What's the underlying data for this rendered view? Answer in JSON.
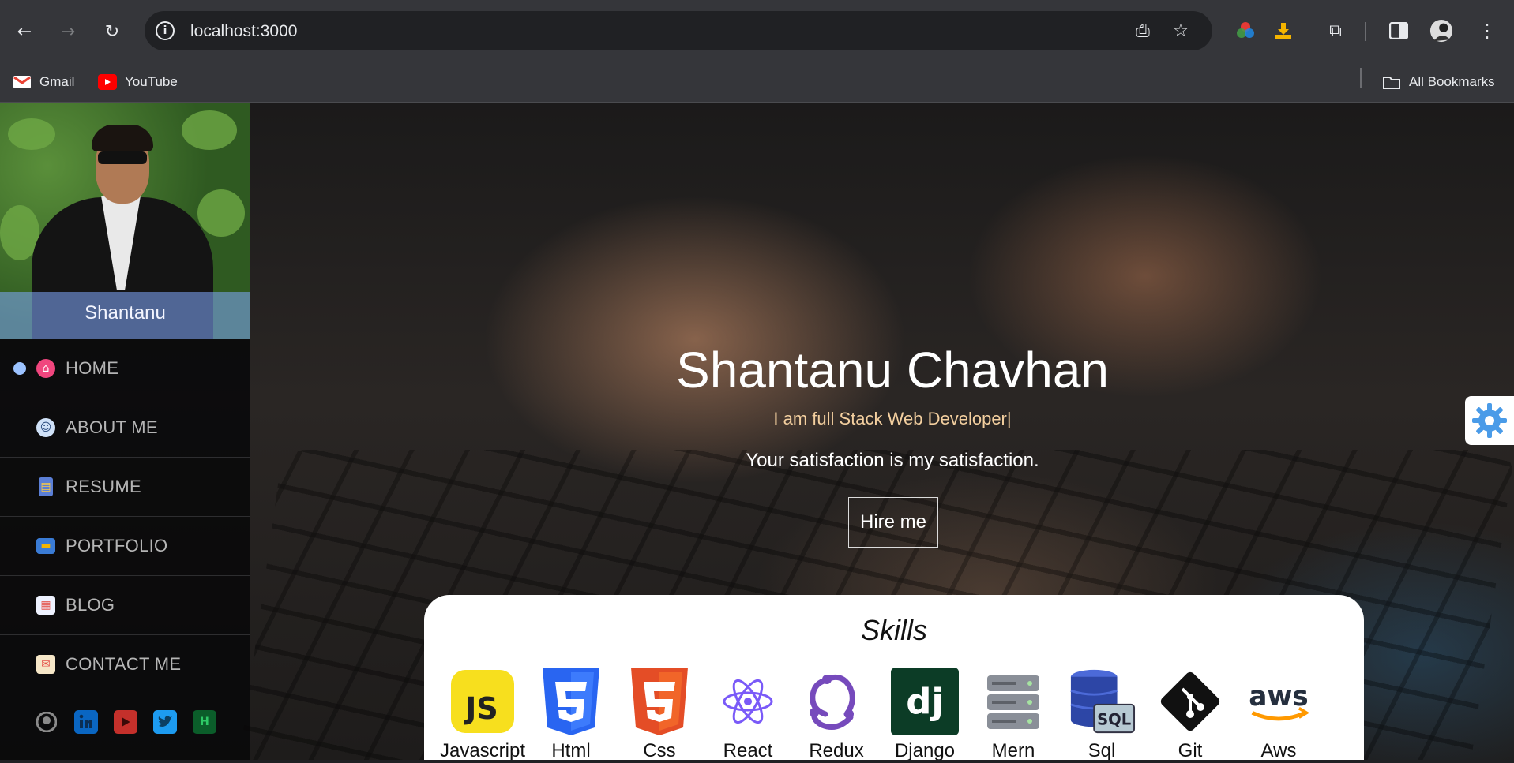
{
  "browser": {
    "url": "localhost:3000",
    "bookmarks": [
      {
        "label": "Gmail",
        "icon": "gmail-icon"
      },
      {
        "label": "YouTube",
        "icon": "youtube-icon"
      }
    ],
    "all_bookmarks_label": "All Bookmarks"
  },
  "sidebar": {
    "profile_name": "Shantanu",
    "menu": [
      {
        "label": "HOME",
        "icon": "home-icon",
        "active": true
      },
      {
        "label": "ABOUT ME",
        "icon": "person-icon",
        "active": false
      },
      {
        "label": "RESUME",
        "icon": "resume-icon",
        "active": false
      },
      {
        "label": "PORTFOLIO",
        "icon": "briefcase-icon",
        "active": false
      },
      {
        "label": "BLOG",
        "icon": "blog-icon",
        "active": false
      },
      {
        "label": "CONTACT ME",
        "icon": "mail-icon",
        "active": false
      }
    ],
    "socials": [
      "github-icon",
      "linkedin-icon",
      "youtube-icon",
      "twitter-icon",
      "hackerrank-icon"
    ]
  },
  "hero": {
    "title": "Shantanu Chavhan",
    "subtitle": "I am full Stack Web Developer|",
    "tagline": "Your satisfaction is my satisfaction.",
    "cta_label": "Hire me"
  },
  "skills": {
    "title": "Skills",
    "items": [
      {
        "name": "Javascript",
        "icon": "javascript-icon"
      },
      {
        "name": "Html",
        "icon": "html5-icon"
      },
      {
        "name": "Css",
        "icon": "css3-icon"
      },
      {
        "name": "React",
        "icon": "react-icon"
      },
      {
        "name": "Redux",
        "icon": "redux-icon"
      },
      {
        "name": "Django",
        "icon": "django-icon"
      },
      {
        "name": "Mern",
        "icon": "server-icon"
      },
      {
        "name": "Sql",
        "icon": "sql-database-icon"
      },
      {
        "name": "Git",
        "icon": "git-icon"
      },
      {
        "name": "Aws",
        "icon": "aws-icon"
      }
    ],
    "logo_labels": {
      "js": "JS",
      "dj": "dj",
      "sql": "SQL",
      "aws": "aws"
    }
  },
  "colors": {
    "accent": "#9cc3ff",
    "subtitle": "#f3cf9f",
    "sidebar_bg": "#080809"
  }
}
